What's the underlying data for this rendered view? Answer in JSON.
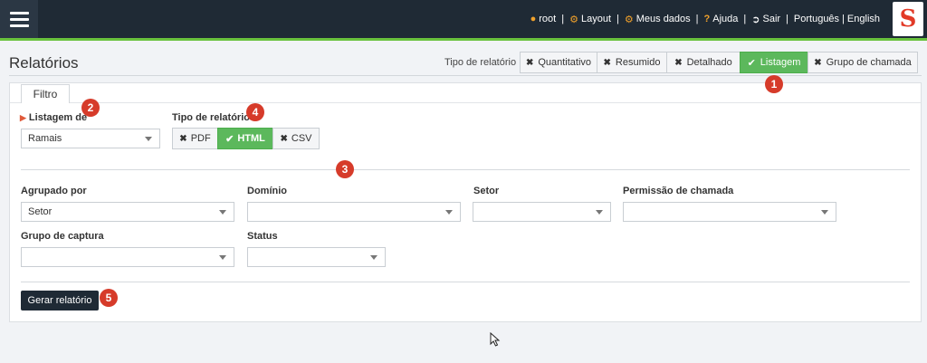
{
  "topbar": {
    "user": "root",
    "layout": "Layout",
    "my_data": "Meus dados",
    "help": "Ajuda",
    "logout": "Sair",
    "lang_pt": "Português",
    "lang_sep": "|",
    "lang_en": "English",
    "separator": "|",
    "logo_letter": "S",
    "accent_color": "#69c23d"
  },
  "page": {
    "title": "Relatórios",
    "type_label": "Tipo de relatório",
    "types": [
      {
        "label": "Quantitativo",
        "active": false
      },
      {
        "label": "Resumido",
        "active": false
      },
      {
        "label": "Detalhado",
        "active": false
      },
      {
        "label": "Listagem",
        "active": true
      },
      {
        "label": "Grupo de chamada",
        "active": false
      }
    ]
  },
  "filter": {
    "tab_label": "Filtro",
    "listagem_label": "Listagem de",
    "listagem_value": "Ramais",
    "format_label": "Tipo de relatório",
    "formats": [
      {
        "label": "PDF",
        "active": false
      },
      {
        "label": "HTML",
        "active": true
      },
      {
        "label": "CSV",
        "active": false
      }
    ],
    "fields": {
      "agrupado_label": "Agrupado por",
      "agrupado_value": "Setor",
      "dominio_label": "Domínio",
      "dominio_value": "",
      "setor_label": "Setor",
      "setor_value": "",
      "permissao_label": "Permissão de chamada",
      "permissao_value": "",
      "grupo_label": "Grupo de captura",
      "grupo_value": "",
      "status_label": "Status",
      "status_value": ""
    },
    "generate_label": "Gerar relatório"
  },
  "badges": [
    "1",
    "2",
    "3",
    "4",
    "5"
  ],
  "colors": {
    "active_green": "#5cb85c",
    "badge_red": "#d63b2a",
    "dark": "#1f2a35"
  }
}
